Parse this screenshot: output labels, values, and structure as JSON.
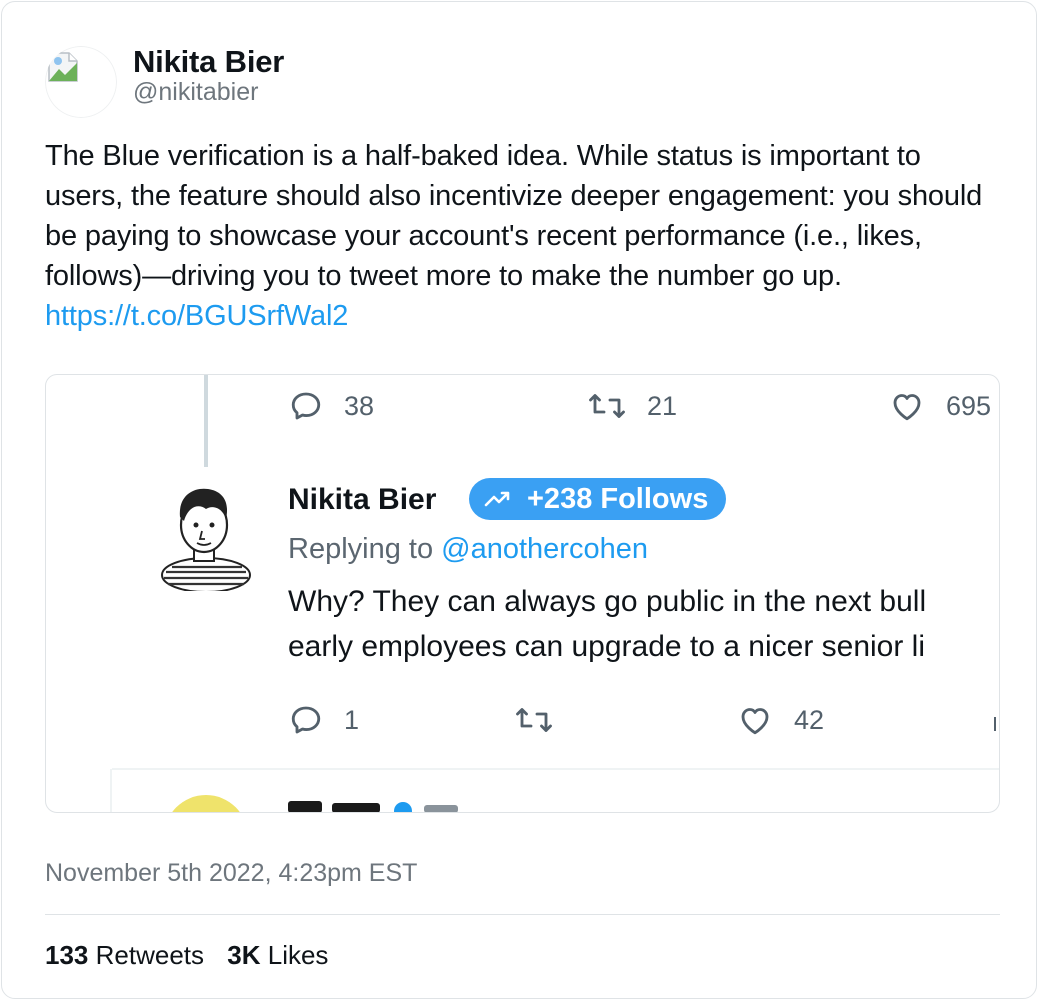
{
  "author": {
    "name": "Nikita Bier",
    "handle": "@nikitabier"
  },
  "tweet": {
    "text": "The Blue verification is a half-baked idea. While status is important to users, the feature should also incentivize deeper engagement: you should be paying to showcase your account's recent performance (i.e., likes, follows)—driving you to tweet more to make the number go up. ",
    "link": "https://t.co/BGUSrfWal2"
  },
  "embedded": {
    "top_actions": {
      "replies": "38",
      "retweets": "21",
      "likes": "695"
    },
    "reply": {
      "name": "Nikita Bier",
      "badge_label": "+238 Follows",
      "replying_prefix": "Replying to ",
      "replying_mention": "@anothercohen",
      "text_line1": "Why? They can always go public in the next bull",
      "text_line2": "early employees can upgrade to a nicer senior li",
      "actions": {
        "replies": "1",
        "retweets": "",
        "likes": "42"
      }
    },
    "colors": {
      "badge": "#3aa0f3",
      "link": "#1d9bf0"
    }
  },
  "footer": {
    "timestamp": "November 5th 2022, 4:23pm EST",
    "retweet_count": "133",
    "retweet_label": "Retweets",
    "like_count": "3K",
    "like_label": "Likes"
  }
}
